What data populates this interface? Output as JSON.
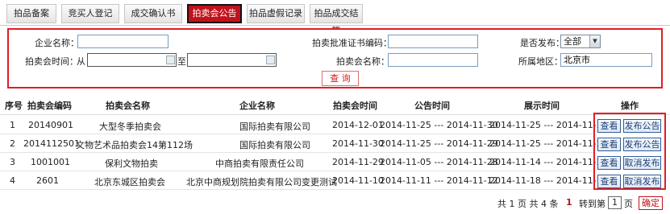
{
  "tabs": [
    {
      "label": "拍品备案"
    },
    {
      "label": "竞买人登记"
    },
    {
      "label": "成交确认书"
    },
    {
      "label": "拍卖会公告"
    },
    {
      "label": "拍品虚假记录"
    },
    {
      "label": "拍品成交结算"
    }
  ],
  "search": {
    "company_label": "企业名称：",
    "company_value": "",
    "cert_label": "拍卖批准证书编码：",
    "cert_value": "",
    "publish_label": "是否发布：",
    "publish_value": "全部",
    "time_label": "拍卖会时间：",
    "time_from": "从",
    "time_to": "至",
    "auction_name_label": "拍卖会名称：",
    "auction_name_value": "",
    "region_label": "所属地区：",
    "region_value": "北京市",
    "query_button": "查  询"
  },
  "table": {
    "headers": [
      "序号",
      "拍卖会编码",
      "拍卖会名称",
      "企业名称",
      "拍卖会时间",
      "公告时间",
      "展示时间",
      "操作"
    ],
    "rows": [
      {
        "no": "1",
        "code": "20140901",
        "name": "大型冬季拍卖会",
        "company": "国际拍卖有限公司",
        "date": "2014-12-01",
        "notice": "2014-11-25 --- 2014-11-30",
        "show": "2014-11-25 --- 2014-11-30",
        "op1": "查看",
        "op2": "发布公告"
      },
      {
        "no": "2",
        "code": "2014112501",
        "name": "文物艺术品拍卖会14第112场",
        "company": "国际拍卖有限公司",
        "date": "2014-11-30",
        "notice": "2014-11-25 --- 2014-11-29",
        "show": "2014-11-25 --- 2014-11-29",
        "op1": "查看",
        "op2": "发布公告"
      },
      {
        "no": "3",
        "code": "1001001",
        "name": "保利文物拍卖",
        "company": "中商拍卖有限责任公司",
        "date": "2014-11-29",
        "notice": "2014-11-05 --- 2014-11-28",
        "show": "2014-11-14 --- 2014-11-28",
        "op1": "查看",
        "op2": "取消发布"
      },
      {
        "no": "4",
        "code": "2601",
        "name": "北京东城区拍卖会",
        "company": "北京中商规划院拍卖有限公司变更测试",
        "date": "2014-11-10",
        "notice": "2014-11-11 --- 2014-11-12",
        "show": "2014-11-18 --- 2014-11-19",
        "op1": "查看",
        "op2": "取消发布"
      }
    ]
  },
  "pager": {
    "summary": "共 1 页  共 4 条",
    "current": "1",
    "goto_label": "转到第",
    "page_value": "1",
    "page_unit": "页",
    "confirm": "确定"
  },
  "colors": {
    "accent": "#c1121b",
    "highlight_border": "#e21d25",
    "button_blue": "#2e5d99"
  }
}
